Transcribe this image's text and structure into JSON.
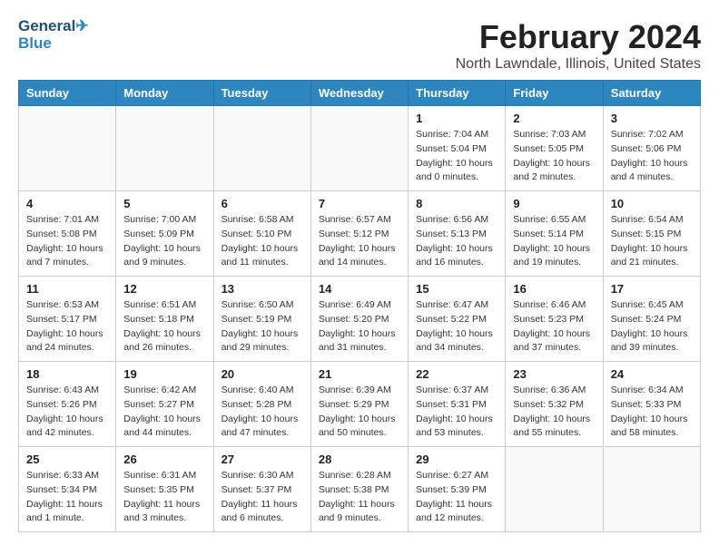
{
  "logo": {
    "line1": "General",
    "line2": "Blue"
  },
  "header": {
    "title": "February 2024",
    "subtitle": "North Lawndale, Illinois, United States"
  },
  "days_of_week": [
    "Sunday",
    "Monday",
    "Tuesday",
    "Wednesday",
    "Thursday",
    "Friday",
    "Saturday"
  ],
  "weeks": [
    [
      {
        "day": "",
        "info": ""
      },
      {
        "day": "",
        "info": ""
      },
      {
        "day": "",
        "info": ""
      },
      {
        "day": "",
        "info": ""
      },
      {
        "day": "1",
        "info": "Sunrise: 7:04 AM\nSunset: 5:04 PM\nDaylight: 10 hours\nand 0 minutes."
      },
      {
        "day": "2",
        "info": "Sunrise: 7:03 AM\nSunset: 5:05 PM\nDaylight: 10 hours\nand 2 minutes."
      },
      {
        "day": "3",
        "info": "Sunrise: 7:02 AM\nSunset: 5:06 PM\nDaylight: 10 hours\nand 4 minutes."
      }
    ],
    [
      {
        "day": "4",
        "info": "Sunrise: 7:01 AM\nSunset: 5:08 PM\nDaylight: 10 hours\nand 7 minutes."
      },
      {
        "day": "5",
        "info": "Sunrise: 7:00 AM\nSunset: 5:09 PM\nDaylight: 10 hours\nand 9 minutes."
      },
      {
        "day": "6",
        "info": "Sunrise: 6:58 AM\nSunset: 5:10 PM\nDaylight: 10 hours\nand 11 minutes."
      },
      {
        "day": "7",
        "info": "Sunrise: 6:57 AM\nSunset: 5:12 PM\nDaylight: 10 hours\nand 14 minutes."
      },
      {
        "day": "8",
        "info": "Sunrise: 6:56 AM\nSunset: 5:13 PM\nDaylight: 10 hours\nand 16 minutes."
      },
      {
        "day": "9",
        "info": "Sunrise: 6:55 AM\nSunset: 5:14 PM\nDaylight: 10 hours\nand 19 minutes."
      },
      {
        "day": "10",
        "info": "Sunrise: 6:54 AM\nSunset: 5:15 PM\nDaylight: 10 hours\nand 21 minutes."
      }
    ],
    [
      {
        "day": "11",
        "info": "Sunrise: 6:53 AM\nSunset: 5:17 PM\nDaylight: 10 hours\nand 24 minutes."
      },
      {
        "day": "12",
        "info": "Sunrise: 6:51 AM\nSunset: 5:18 PM\nDaylight: 10 hours\nand 26 minutes."
      },
      {
        "day": "13",
        "info": "Sunrise: 6:50 AM\nSunset: 5:19 PM\nDaylight: 10 hours\nand 29 minutes."
      },
      {
        "day": "14",
        "info": "Sunrise: 6:49 AM\nSunset: 5:20 PM\nDaylight: 10 hours\nand 31 minutes."
      },
      {
        "day": "15",
        "info": "Sunrise: 6:47 AM\nSunset: 5:22 PM\nDaylight: 10 hours\nand 34 minutes."
      },
      {
        "day": "16",
        "info": "Sunrise: 6:46 AM\nSunset: 5:23 PM\nDaylight: 10 hours\nand 37 minutes."
      },
      {
        "day": "17",
        "info": "Sunrise: 6:45 AM\nSunset: 5:24 PM\nDaylight: 10 hours\nand 39 minutes."
      }
    ],
    [
      {
        "day": "18",
        "info": "Sunrise: 6:43 AM\nSunset: 5:26 PM\nDaylight: 10 hours\nand 42 minutes."
      },
      {
        "day": "19",
        "info": "Sunrise: 6:42 AM\nSunset: 5:27 PM\nDaylight: 10 hours\nand 44 minutes."
      },
      {
        "day": "20",
        "info": "Sunrise: 6:40 AM\nSunset: 5:28 PM\nDaylight: 10 hours\nand 47 minutes."
      },
      {
        "day": "21",
        "info": "Sunrise: 6:39 AM\nSunset: 5:29 PM\nDaylight: 10 hours\nand 50 minutes."
      },
      {
        "day": "22",
        "info": "Sunrise: 6:37 AM\nSunset: 5:31 PM\nDaylight: 10 hours\nand 53 minutes."
      },
      {
        "day": "23",
        "info": "Sunrise: 6:36 AM\nSunset: 5:32 PM\nDaylight: 10 hours\nand 55 minutes."
      },
      {
        "day": "24",
        "info": "Sunrise: 6:34 AM\nSunset: 5:33 PM\nDaylight: 10 hours\nand 58 minutes."
      }
    ],
    [
      {
        "day": "25",
        "info": "Sunrise: 6:33 AM\nSunset: 5:34 PM\nDaylight: 11 hours\nand 1 minute."
      },
      {
        "day": "26",
        "info": "Sunrise: 6:31 AM\nSunset: 5:35 PM\nDaylight: 11 hours\nand 3 minutes."
      },
      {
        "day": "27",
        "info": "Sunrise: 6:30 AM\nSunset: 5:37 PM\nDaylight: 11 hours\nand 6 minutes."
      },
      {
        "day": "28",
        "info": "Sunrise: 6:28 AM\nSunset: 5:38 PM\nDaylight: 11 hours\nand 9 minutes."
      },
      {
        "day": "29",
        "info": "Sunrise: 6:27 AM\nSunset: 5:39 PM\nDaylight: 11 hours\nand 12 minutes."
      },
      {
        "day": "",
        "info": ""
      },
      {
        "day": "",
        "info": ""
      }
    ]
  ]
}
